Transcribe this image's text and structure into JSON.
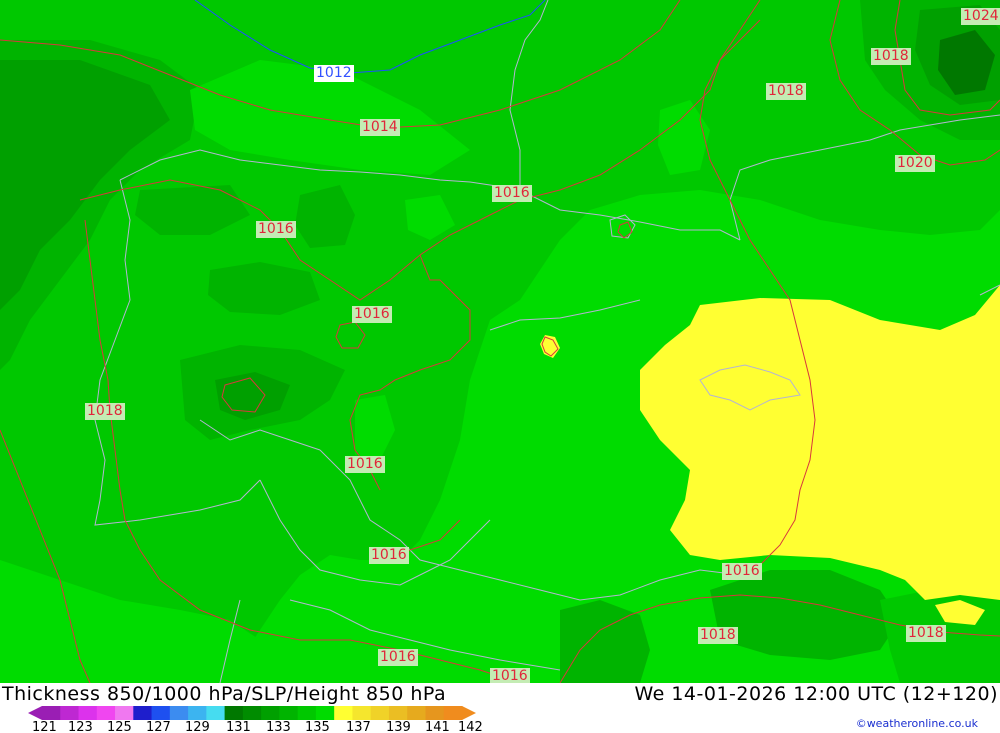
{
  "map": {
    "colors": {
      "dark_green": "#00a000",
      "mid_green": "#00b400",
      "green": "#00c800",
      "bright_green": "#00dc00",
      "yellow": "#ffff32",
      "isobar_red": "#d8383c",
      "isobar_blue": "#1e50ff",
      "coast": "#b4b4d2"
    },
    "isobar_labels": [
      {
        "id": "i1012",
        "text": "1012",
        "style": "blue"
      },
      {
        "id": "i1014",
        "text": "1014"
      },
      {
        "id": "i1016a",
        "text": "1016"
      },
      {
        "id": "i1016b",
        "text": "1016"
      },
      {
        "id": "i1016c",
        "text": "1016"
      },
      {
        "id": "i1016d",
        "text": "1016"
      },
      {
        "id": "i1016e",
        "text": "1016"
      },
      {
        "id": "i1016f",
        "text": "1016"
      },
      {
        "id": "i1016g",
        "text": "1016"
      },
      {
        "id": "i1016h",
        "text": "1016"
      },
      {
        "id": "i1018a",
        "text": "1018"
      },
      {
        "id": "i1018b",
        "text": "1018"
      },
      {
        "id": "i1018c",
        "text": "1018"
      },
      {
        "id": "i1018d",
        "text": "1018"
      },
      {
        "id": "i1018e",
        "text": "1018"
      },
      {
        "id": "i1020",
        "text": "1020"
      },
      {
        "id": "i1024",
        "text": "1024"
      }
    ]
  },
  "footer": {
    "title": "Thickness 850/1000 hPa/SLP/Height 850 hPa",
    "datetime": "We 14-01-2026 12:00 UTC (12+120)",
    "credit": "©weatheronline.co.uk"
  },
  "legend": {
    "colors": [
      "#9a1eb4",
      "#be28d2",
      "#dc32ec",
      "#f046f0",
      "#f078f0",
      "#1e1ecc",
      "#1e50f0",
      "#3c8cf0",
      "#3cb4f0",
      "#46dcf0",
      "#007800",
      "#008c00",
      "#00a000",
      "#00b400",
      "#00c800",
      "#00dc00",
      "#ffff32",
      "#f5e62d",
      "#f0d228",
      "#ebbe23",
      "#e6aa1e",
      "#e6961e",
      "#f08c1e"
    ],
    "ticks": [
      "121",
      "123",
      "125",
      "127",
      "129",
      "131",
      "133",
      "135",
      "137",
      "139",
      "141",
      "142"
    ]
  }
}
